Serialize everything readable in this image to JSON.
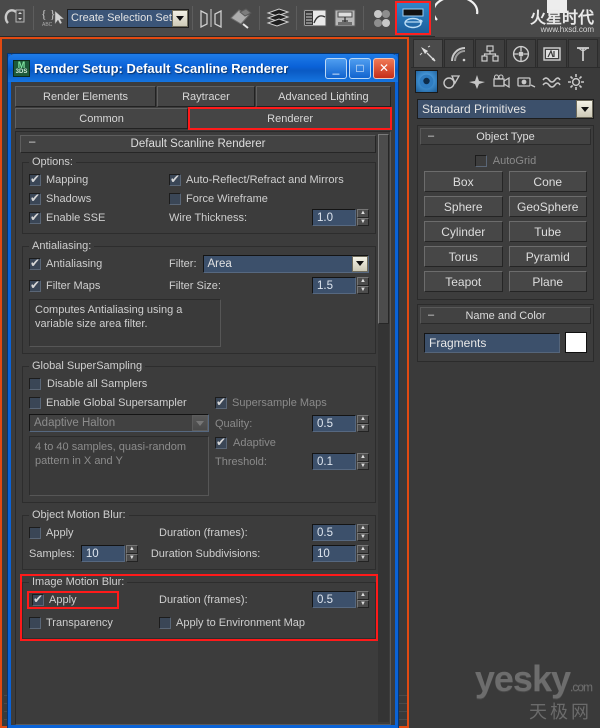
{
  "toolbar": {
    "icons": [
      {
        "name": "snaps-toggle-icon",
        "glyph": "⌒"
      },
      {
        "name": "named-selection-sets-icon",
        "glyph": "{ }"
      },
      {
        "name": "mirror-icon",
        "glyph": "▶|◀"
      },
      {
        "name": "align-icon",
        "glyph": "◆"
      },
      {
        "name": "layer-manager-icon",
        "glyph": "≋"
      },
      {
        "name": "curve-editor-icon",
        "glyph": "▤"
      },
      {
        "name": "schematic-view-icon",
        "glyph": "▣"
      },
      {
        "name": "material-editor-icon",
        "glyph": "●●"
      },
      {
        "name": "render-setup-icon",
        "glyph": "▬"
      }
    ],
    "selection_set_value": "Create Selection Set",
    "brand_name": "火星时代",
    "brand_url": "www.hxsd.com"
  },
  "dialog": {
    "title": "Render Setup: Default Scanline Renderer",
    "minimize_label": "_",
    "maximize_label": "□",
    "close_label": "✕",
    "tabs_row1": [
      "Render Elements",
      "Raytracer",
      "Advanced Lighting"
    ],
    "tabs_row2": [
      "Common",
      "Renderer"
    ],
    "active_tab": "Renderer",
    "rollout_title": "Default Scanline Renderer",
    "options": {
      "legend": "Options:",
      "mapping": {
        "label": "Mapping",
        "checked": true
      },
      "shadows": {
        "label": "Shadows",
        "checked": true
      },
      "enable_sse": {
        "label": "Enable SSE",
        "checked": true
      },
      "auto_reflect": {
        "label": "Auto-Reflect/Refract and Mirrors",
        "checked": true
      },
      "force_wireframe": {
        "label": "Force Wireframe",
        "checked": false
      },
      "wire_thickness_label": "Wire Thickness:",
      "wire_thickness_value": "1.0"
    },
    "antialiasing": {
      "legend": "Antialiasing:",
      "antialiasing": {
        "label": "Antialiasing",
        "checked": true
      },
      "filter_label": "Filter:",
      "filter_value": "Area",
      "filter_maps": {
        "label": "Filter Maps",
        "checked": true
      },
      "filter_size_label": "Filter Size:",
      "filter_size_value": "1.5",
      "description": "Computes Antialiasing using a variable size area filter."
    },
    "supersampling": {
      "legend": "Global SuperSampling",
      "disable_all": {
        "label": "Disable all Samplers",
        "checked": false
      },
      "enable_global": {
        "label": "Enable Global Supersampler",
        "checked": false
      },
      "sampler_value": "Adaptive Halton",
      "sampler_description": "4 to 40 samples, quasi-random pattern in X and Y",
      "supersample_maps": {
        "label": "Supersample Maps",
        "checked": true
      },
      "quality_label": "Quality:",
      "quality_value": "0.5",
      "adaptive": {
        "label": "Adaptive",
        "checked": true
      },
      "threshold_label": "Threshold:",
      "threshold_value": "0.1"
    },
    "object_motion_blur": {
      "legend": "Object Motion Blur:",
      "apply": {
        "label": "Apply",
        "checked": false
      },
      "duration_label": "Duration (frames):",
      "duration_value": "0.5",
      "samples_label": "Samples:",
      "samples_value": "10",
      "subdivisions_label": "Duration Subdivisions:",
      "subdivisions_value": "10"
    },
    "image_motion_blur": {
      "legend": "Image Motion Blur:",
      "apply": {
        "label": "Apply",
        "checked": true
      },
      "duration_label": "Duration (frames):",
      "duration_value": "0.5",
      "transparency": {
        "label": "Transparency",
        "checked": false
      },
      "apply_env_map": {
        "label": "Apply to Environment Map",
        "checked": false
      }
    }
  },
  "command_panel": {
    "tabs": [
      {
        "name": "create-tab",
        "glyph": "✳"
      },
      {
        "name": "modify-tab",
        "glyph": "◜"
      },
      {
        "name": "hierarchy-tab",
        "glyph": "⛬"
      },
      {
        "name": "motion-tab",
        "glyph": "◎"
      },
      {
        "name": "display-tab",
        "glyph": "▣"
      },
      {
        "name": "utilities-tab",
        "glyph": "⊤"
      }
    ],
    "subtabs": [
      {
        "name": "geometry-button",
        "glyph": "◉"
      },
      {
        "name": "shapes-button",
        "glyph": "⬡"
      },
      {
        "name": "lights-button",
        "glyph": "✦"
      },
      {
        "name": "cameras-button",
        "glyph": "🎥"
      },
      {
        "name": "helpers-button",
        "glyph": "▤"
      },
      {
        "name": "space-warps-button",
        "glyph": "≈"
      },
      {
        "name": "systems-button",
        "glyph": "✺"
      }
    ],
    "category_value": "Standard Primitives",
    "object_type": {
      "title": "Object Type",
      "autogrid": {
        "label": "AutoGrid",
        "checked": false
      },
      "buttons": [
        "Box",
        "Cone",
        "Sphere",
        "GeoSphere",
        "Cylinder",
        "Tube",
        "Torus",
        "Pyramid",
        "Teapot",
        "Plane"
      ]
    },
    "name_and_color": {
      "title": "Name and Color",
      "name_value": "Fragments",
      "color": "#ffffff"
    }
  },
  "watermark": {
    "main": "yesky",
    "suffix": ".com",
    "cn": "天极网"
  }
}
